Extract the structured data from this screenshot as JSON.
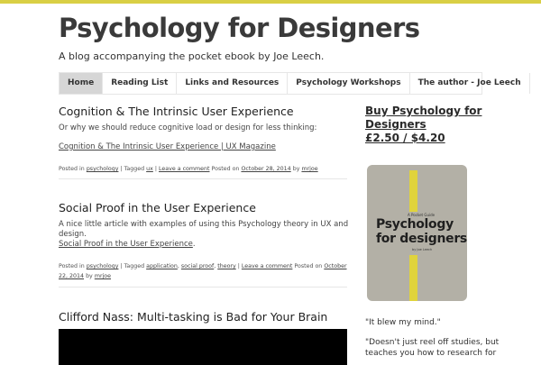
{
  "site": {
    "title": "Psychology for Designers",
    "tagline": "A blog accompanying the pocket ebook by Joe Leech."
  },
  "colors": {
    "accent_bar": "#d9cf45",
    "nav_active": "#d6d6d6",
    "book_cover": "#b3b0a6",
    "book_stripe": "#e0d33c"
  },
  "nav": {
    "items": [
      {
        "label": "Home",
        "active": true
      },
      {
        "label": "Reading List"
      },
      {
        "label": "Links and Resources"
      },
      {
        "label": "Psychology Workshops"
      },
      {
        "label": "The author - Joe Leech"
      }
    ]
  },
  "posts": [
    {
      "title": "Cognition & The Intrinsic User Experience",
      "excerpt": "Or why we should reduce cognitive load or design for less thinking:",
      "link": "Cognition & The Intrinsic User Experience | UX Magazine",
      "meta": {
        "posted_in_label": "Posted in",
        "category": "psychology",
        "tagged_label": "| Tagged",
        "tags": [
          "ux"
        ],
        "comment": "Leave a comment",
        "posted_on_label": "Posted on",
        "date": "October 28, 2014",
        "by_label": "by",
        "author": "mrjoe"
      }
    },
    {
      "title": "Social Proof in the User Experience",
      "excerpt_line1": "A nice little article with examples of using this Psychology theory in UX and",
      "excerpt_line2": "design.",
      "link": "Social Proof in the User Experience",
      "meta": {
        "posted_in_label": "Posted in",
        "category": "psychology",
        "tagged_label": "| Tagged",
        "tags": [
          "application",
          "social proof",
          "theory"
        ],
        "comment": "Leave a comment",
        "posted_on_label": "Posted on",
        "date": "October 22, 2014",
        "by_label": "by",
        "author": "mrjoe"
      }
    },
    {
      "title": "Clifford Nass: Multi-tasking is Bad for Your Brain"
    }
  ],
  "sidebar": {
    "buy_line1": "Buy Psychology for",
    "buy_line2": "Designers",
    "buy_line3": "£2.50 / $4.20",
    "book": {
      "subtitle": "A Pocket Guide",
      "title_line1": "Psychology",
      "title_line2": "for designers",
      "author": "by Joe Leech"
    },
    "quote1": "\"It blew my mind.\"",
    "quote2_line1": "\"Doesn't just reel off studies, but",
    "quote2_line2": "teaches you how to research for"
  }
}
